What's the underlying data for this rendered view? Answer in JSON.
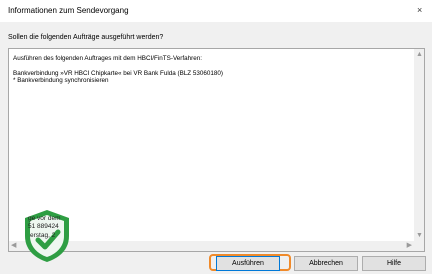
{
  "window": {
    "title": "Informationen zum Sendevorgang",
    "close_glyph": "×"
  },
  "prompt": "Sollen die folgenden Aufträge ausgeführt werden?",
  "details": {
    "lines": [
      "Ausführen des folgenden Auftrages mit dem HBCI/FinTS-Verfahren:",
      "Bankverbindung »VR HBCI Chipkarte« bei VR Bank Fulda (BLZ 53060180)",
      "* Bankverbindung synchronisieren"
    ]
  },
  "shield": {
    "line1": "ge vor dem",
    "line2": "51 889424",
    "line3": "erstag, 2",
    "color": "#2e9e43"
  },
  "buttons": {
    "execute": "Ausführen",
    "cancel": "Abbrechen",
    "help": "Hilfe"
  },
  "icons": {
    "scroll_up": "▲",
    "scroll_down": "▼",
    "scroll_left": "◀",
    "scroll_right": "▶"
  },
  "colors": {
    "focus_highlight": "#f08a2a",
    "default_button_border": "#0078d7"
  }
}
